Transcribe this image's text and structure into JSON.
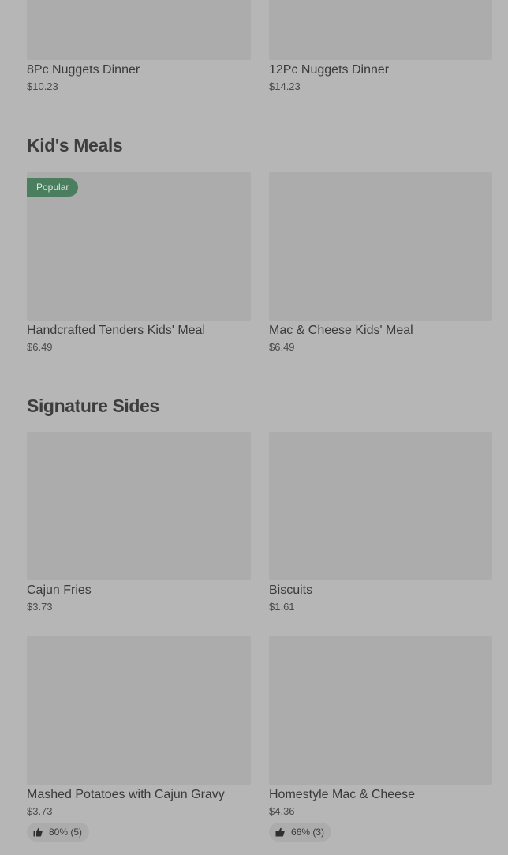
{
  "sections": [
    {
      "title": "",
      "items": [
        {
          "name": "8Pc Nuggets Dinner",
          "price": "$10.23"
        },
        {
          "name": "12Pc Nuggets Dinner",
          "price": "$14.23"
        }
      ]
    },
    {
      "title": "Kid's Meals",
      "items": [
        {
          "name": "Handcrafted Tenders Kids' Meal",
          "price": "$6.49",
          "badge": "Popular"
        },
        {
          "name": "Mac & Cheese Kids' Meal",
          "price": "$6.49"
        }
      ]
    },
    {
      "title": "Signature Sides",
      "items": [
        {
          "name": "Cajun Fries",
          "price": "$3.73"
        },
        {
          "name": "Biscuits",
          "price": "$1.61"
        },
        {
          "name": "Mashed Potatoes with Cajun Gravy",
          "price": "$3.73",
          "rating": "80% (5)"
        },
        {
          "name": "Homestyle Mac & Cheese",
          "price": "$4.36",
          "rating": "66% (3)"
        }
      ]
    }
  ],
  "icons": {
    "rating": "thumbs-up-icon"
  },
  "colors": {
    "background": "#b6b6b6",
    "image_placeholder": "#acacac",
    "badge": "#4a7e5e"
  }
}
